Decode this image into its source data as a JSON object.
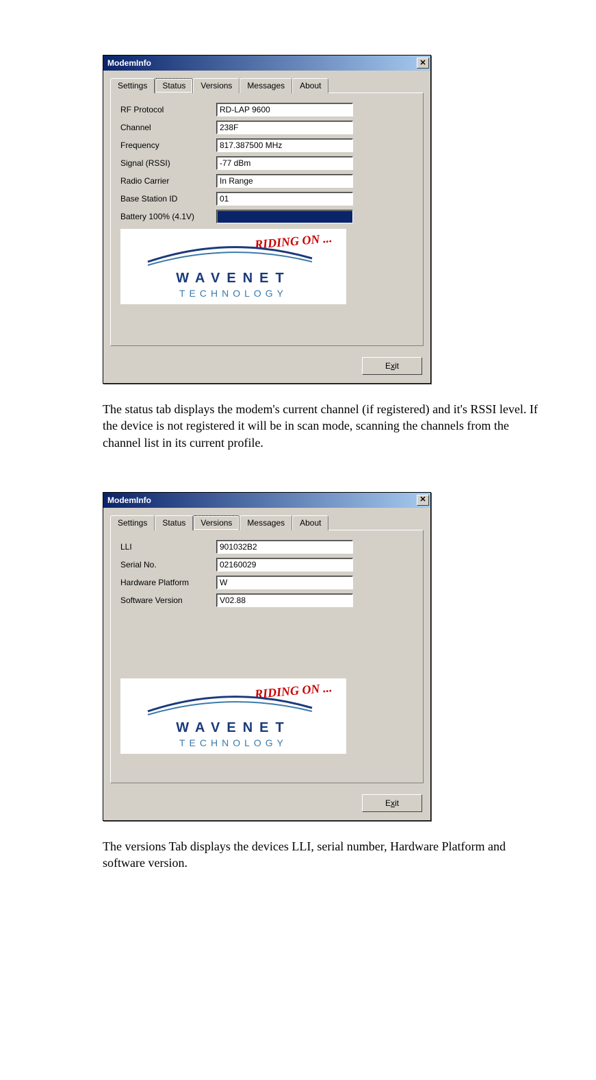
{
  "window1": {
    "title": "ModemInfo",
    "tabs": [
      "Settings",
      "Status",
      "Versions",
      "Messages",
      "About"
    ],
    "active_tab": "Status",
    "rows": [
      {
        "label": "RF Protocol",
        "value": "RD-LAP 9600"
      },
      {
        "label": "Channel",
        "value": "238F"
      },
      {
        "label": "Frequency",
        "value": "817.387500 MHz"
      },
      {
        "label": "Signal (RSSI)",
        "value": "-77 dBm"
      },
      {
        "label": "Radio Carrier",
        "value": "In Range"
      },
      {
        "label": "Base Station ID",
        "value": "01"
      },
      {
        "label": "Battery 100% (4.1V)",
        "value": "",
        "battery": true
      }
    ],
    "logo_script": "RIDING ON ...",
    "logo_main": "WAVENET",
    "logo_sub": "TECHNOLOGY",
    "exit_label": "Exit",
    "exit_letter": "x"
  },
  "para1": "The status tab displays the modem's current channel (if registered) and it's RSSI level. If the device is not registered it will be in scan mode, scanning the channels from the channel list in its current profile.",
  "window2": {
    "title": "ModemInfo",
    "tabs": [
      "Settings",
      "Status",
      "Versions",
      "Messages",
      "About"
    ],
    "active_tab": "Versions",
    "rows": [
      {
        "label": "LLI",
        "value": "901032B2"
      },
      {
        "label": "Serial No.",
        "value": "02160029"
      },
      {
        "label": "Hardware Platform",
        "value": "W"
      },
      {
        "label": "Software Version",
        "value": "V02.88"
      }
    ],
    "logo_script": "RIDING ON ...",
    "logo_main": "WAVENET",
    "logo_sub": "TECHNOLOGY",
    "exit_label": "Exit",
    "exit_letter": "x"
  },
  "para2": "The versions Tab displays the devices LLI, serial number, Hardware Platform and software version."
}
